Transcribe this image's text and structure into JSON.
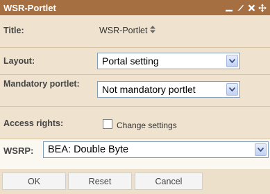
{
  "portlet": {
    "title": "WSR-Portlet",
    "controls": {
      "minimize": "_",
      "edit": "✎",
      "close": "✕",
      "move": "✥"
    }
  },
  "form": {
    "title_label": "Title:",
    "title_value": "WSR-Portlet",
    "title_sort_icon": "sort-icon",
    "layout_label": "Layout:",
    "layout_value": "Portal setting",
    "mandatory_label": "Mandatory portlet:",
    "mandatory_value": "Not mandatory portlet",
    "access_label": "Access rights:",
    "access_checkbox_label": "Change settings",
    "access_checked": false,
    "wsrp_label": "WSRP:",
    "wsrp_value": "BEA: Double Byte"
  },
  "buttons": {
    "ok": "OK",
    "reset": "Reset",
    "cancel": "Cancel"
  },
  "colors": {
    "titlebar": "#a56f41",
    "row_shade": "#efe3cf",
    "select_border": "#7f9db9"
  }
}
